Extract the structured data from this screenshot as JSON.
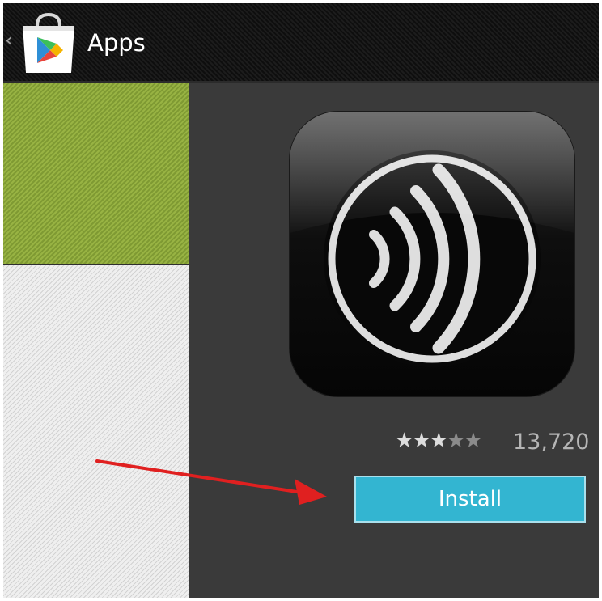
{
  "action_bar": {
    "back_glyph": "‹",
    "title": "Apps",
    "store_icon": "play-store-bag-icon"
  },
  "app": {
    "icon": "sound-waves-icon",
    "rating": {
      "stars_filled": 3,
      "stars_total": 5,
      "count": "13,720"
    },
    "install_label": "Install"
  },
  "colors": {
    "install_button": "#33b5d1",
    "green_tile": "#8aa53a",
    "arrow": "#e02020",
    "background": "#3a3a3a"
  }
}
